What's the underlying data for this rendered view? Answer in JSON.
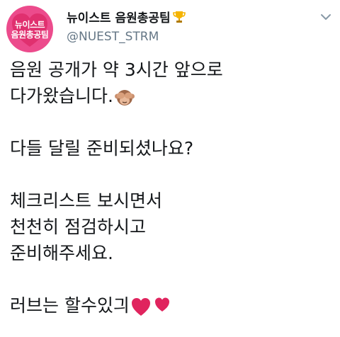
{
  "profile": {
    "avatar_line1": "뉴이스트",
    "avatar_line2": "음원총공팀",
    "display_name": "뉴이스트 음원총공팀",
    "handle": "@NUEST_STRM",
    "name_emoji": "trophy-icon",
    "accent_color": "#ec4b8c"
  },
  "tweet": {
    "line1": "음원 공개가 약 3시간 앞으로",
    "line2": "다가왔습니다.",
    "line2_emoji": "see-no-evil-monkey-icon",
    "line3": "다들 달릴 준비되셨나요?",
    "line4": "체크리스트 보시면서",
    "line5": "천천히 점검하시고",
    "line6": "준비해주세요.",
    "line7": "러브는 할수있긔",
    "line7_emoji": "two-hearts-icon"
  },
  "menu": {
    "icon": "chevron-down-icon"
  }
}
